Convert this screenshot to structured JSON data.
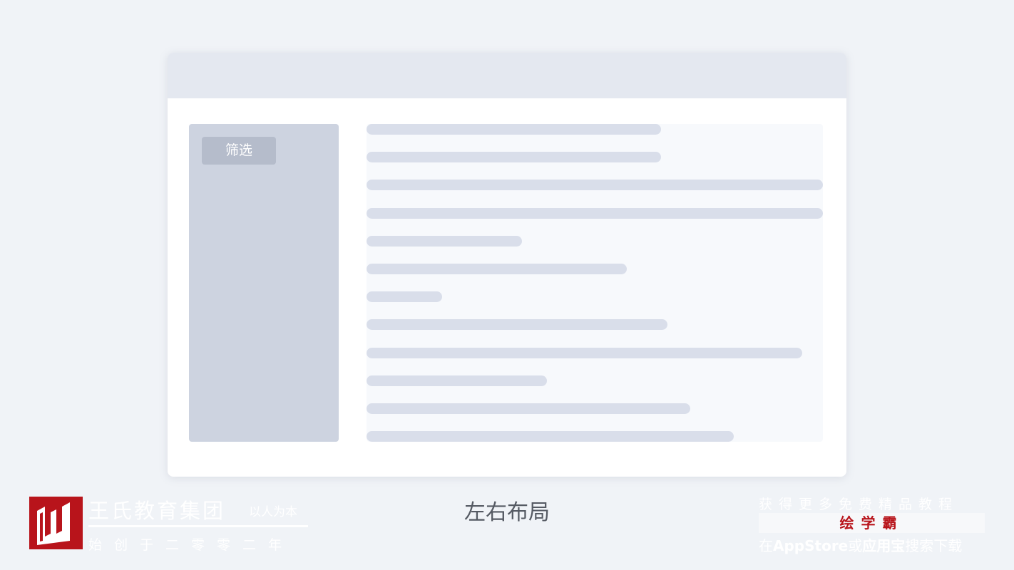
{
  "layout_demo": {
    "filter_button_label": "筛选",
    "content_lines": [
      {
        "fill": 0.645
      },
      {
        "fill": 0.645
      },
      {
        "fill": 1.0
      },
      {
        "fill": 1.0
      },
      {
        "fill": 0.34
      },
      {
        "fill": 0.57
      },
      {
        "fill": 0.165
      },
      {
        "fill": 0.66
      },
      {
        "fill": 0.955
      },
      {
        "fill": 0.395
      },
      {
        "fill": 0.71
      },
      {
        "fill": 0.805
      }
    ]
  },
  "caption": "左右布局",
  "organization": {
    "name": "王氏教育集团",
    "slogan": "以人为本",
    "founded": "始创于二零零二年"
  },
  "promo": {
    "top_line": "获得更多免费精品教程",
    "brand": "绘学霸",
    "bottom_prefix": "在",
    "bottom_store1": "AppStore",
    "bottom_or": "或",
    "bottom_store2": "应用宝",
    "bottom_suffix": "搜索下载"
  },
  "colors": {
    "background": "#f0f3f7",
    "window": "#ffffff",
    "header": "#e4e8f0",
    "sidebar": "#cdd3e0",
    "filter_button": "#b5bccb",
    "content_area": "#f7f9fc",
    "skeleton_line": "#d9deea",
    "brand_red": "#b8141b"
  }
}
